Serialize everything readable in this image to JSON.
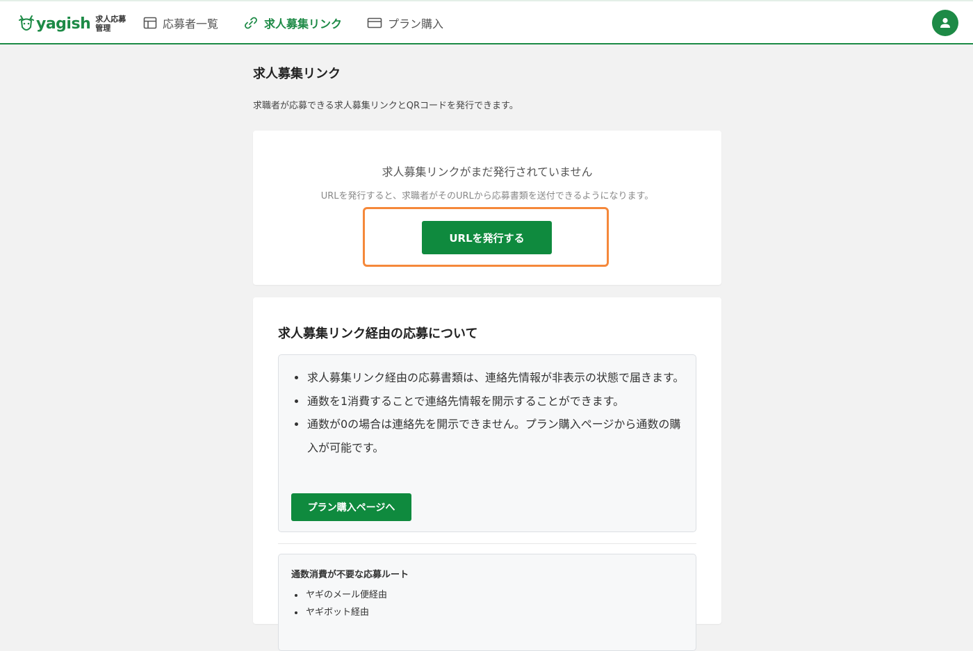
{
  "header": {
    "logo_text": "yagish",
    "logo_sub": "求人応募管理",
    "nav": [
      {
        "label": "応募者一覧",
        "icon": "table-icon",
        "active": false
      },
      {
        "label": "求人募集リンク",
        "icon": "link-icon",
        "active": true
      },
      {
        "label": "プラン購入",
        "icon": "card-icon",
        "active": false
      }
    ],
    "avatar_icon": "user-icon"
  },
  "main": {
    "title": "求人募集リンク",
    "description": "求職者が応募できる求人募集リンクとQRコードを発行できます。",
    "empty_state": {
      "title": "求人募集リンクがまだ発行されていません",
      "subtitle": "URLを発行すると、求職者がそのURLから応募書類を送付できるようになります。",
      "button_label": "URLを発行する"
    },
    "about": {
      "title": "求人募集リンク経由の応募について",
      "items": [
        "求人募集リンク経由の応募書類は、連絡先情報が非表示の状態で届きます。",
        "通数を1消費することで連絡先情報を開示することができます。",
        "通数が0の場合は連絡先を開示できません。プラン購入ページから通数の購入が可能です。"
      ],
      "button_label": "プラン購入ページへ"
    },
    "routes": {
      "title": "通数消費が不要な応募ルート",
      "items": [
        "ヤギのメール便経由",
        "ヤギボット経由"
      ]
    }
  },
  "colors": {
    "brand": "#1d8a46",
    "button": "#0f8a3e",
    "highlight": "#f5883a"
  }
}
